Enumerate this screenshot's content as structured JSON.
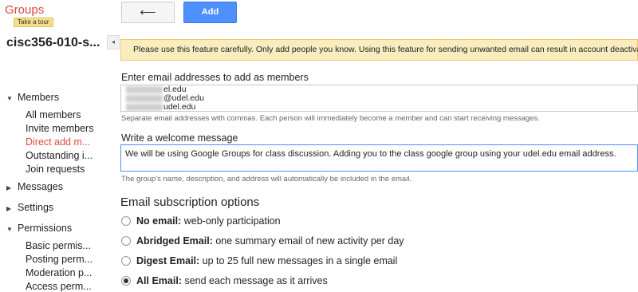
{
  "app": {
    "brand": "Groups",
    "tour_label": "Take a tour"
  },
  "toolbar": {
    "back_glyph": "⟵",
    "add_label": "Add"
  },
  "sidebar": {
    "group_title": "cisc356-010-s...",
    "collapse_glyph": "◂",
    "sections": [
      {
        "label": "Members",
        "expanded": true
      },
      {
        "label": "Messages",
        "expanded": false
      },
      {
        "label": "Settings",
        "expanded": false
      },
      {
        "label": "Permissions",
        "expanded": true
      }
    ],
    "members_items": [
      "All members",
      "Invite members",
      "Direct add m...",
      "Outstanding i...",
      "Join requests"
    ],
    "active_item": "Direct add m...",
    "permissions_items": [
      "Basic permis...",
      "Posting perm...",
      "Moderation p...",
      "Access perm..."
    ]
  },
  "warning": "Please use this feature carefully. Only add people you know. Using this feature for sending unwanted email can result in account deactivation.",
  "emails": {
    "label": "Enter email addresses to add as members",
    "lines": [
      "el.edu",
      "@udel.edu",
      "udel.edu"
    ],
    "hint": "Separate email addresses with commas. Each person will immediately become a member and can start receiving messages."
  },
  "welcome": {
    "label": "Write a welcome message",
    "value": "We will be using Google Groups for class discussion. Adding you to the class google group using your udel.edu email address.",
    "hint": "The group's name, description, and address will automatically be included in the email."
  },
  "subscription": {
    "title": "Email subscription options",
    "options": [
      {
        "name": "No email:",
        "desc": " web-only participation",
        "checked": false
      },
      {
        "name": "Abridged Email:",
        "desc": " one summary email of new activity per day",
        "checked": false
      },
      {
        "name": "Digest Email:",
        "desc": " up to 25 full new messages in a single email",
        "checked": false
      },
      {
        "name": "All Email:",
        "desc": " send each message as it arrives",
        "checked": true
      }
    ]
  },
  "colors": {
    "accent": "#4d90fe",
    "brand": "#dd4b39",
    "warning_bg": "#f9edbe"
  }
}
